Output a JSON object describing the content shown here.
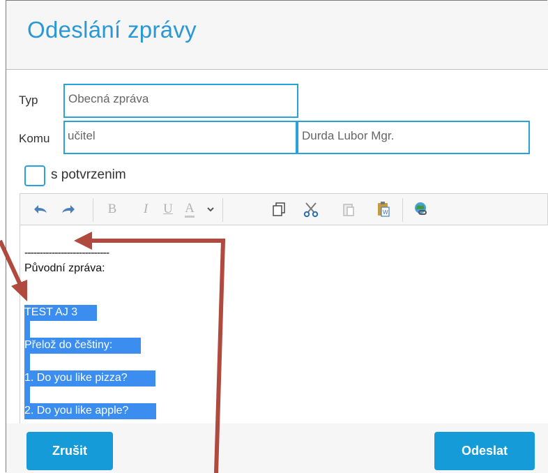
{
  "dialog": {
    "title": "Odeslání zprávy"
  },
  "form": {
    "type_label": "Typ",
    "type_value": "Obecná zpráva",
    "to_label": "Komu",
    "to_role_value": "učitel",
    "to_person_value": "Durda Lubor Mgr.",
    "confirm_label": "s potvrzenim"
  },
  "toolbar": {
    "bold_label": "B",
    "italic_label": "I",
    "underline_label": "U",
    "font_color_label": "A"
  },
  "editor": {
    "separator": "----------------------------",
    "original_label": "Původní zpráva:",
    "lines": [
      "TEST AJ 3",
      "Přelož do češtiny:",
      "1. Do you like pizza?",
      "2. Do you like apple?"
    ]
  },
  "buttons": {
    "cancel": "Zrušit",
    "send": "Odeslat"
  },
  "colors": {
    "accent": "#159bd8",
    "title": "#2a97d6",
    "selection": "#3b8ef0",
    "annotation": "#b04a3f"
  }
}
